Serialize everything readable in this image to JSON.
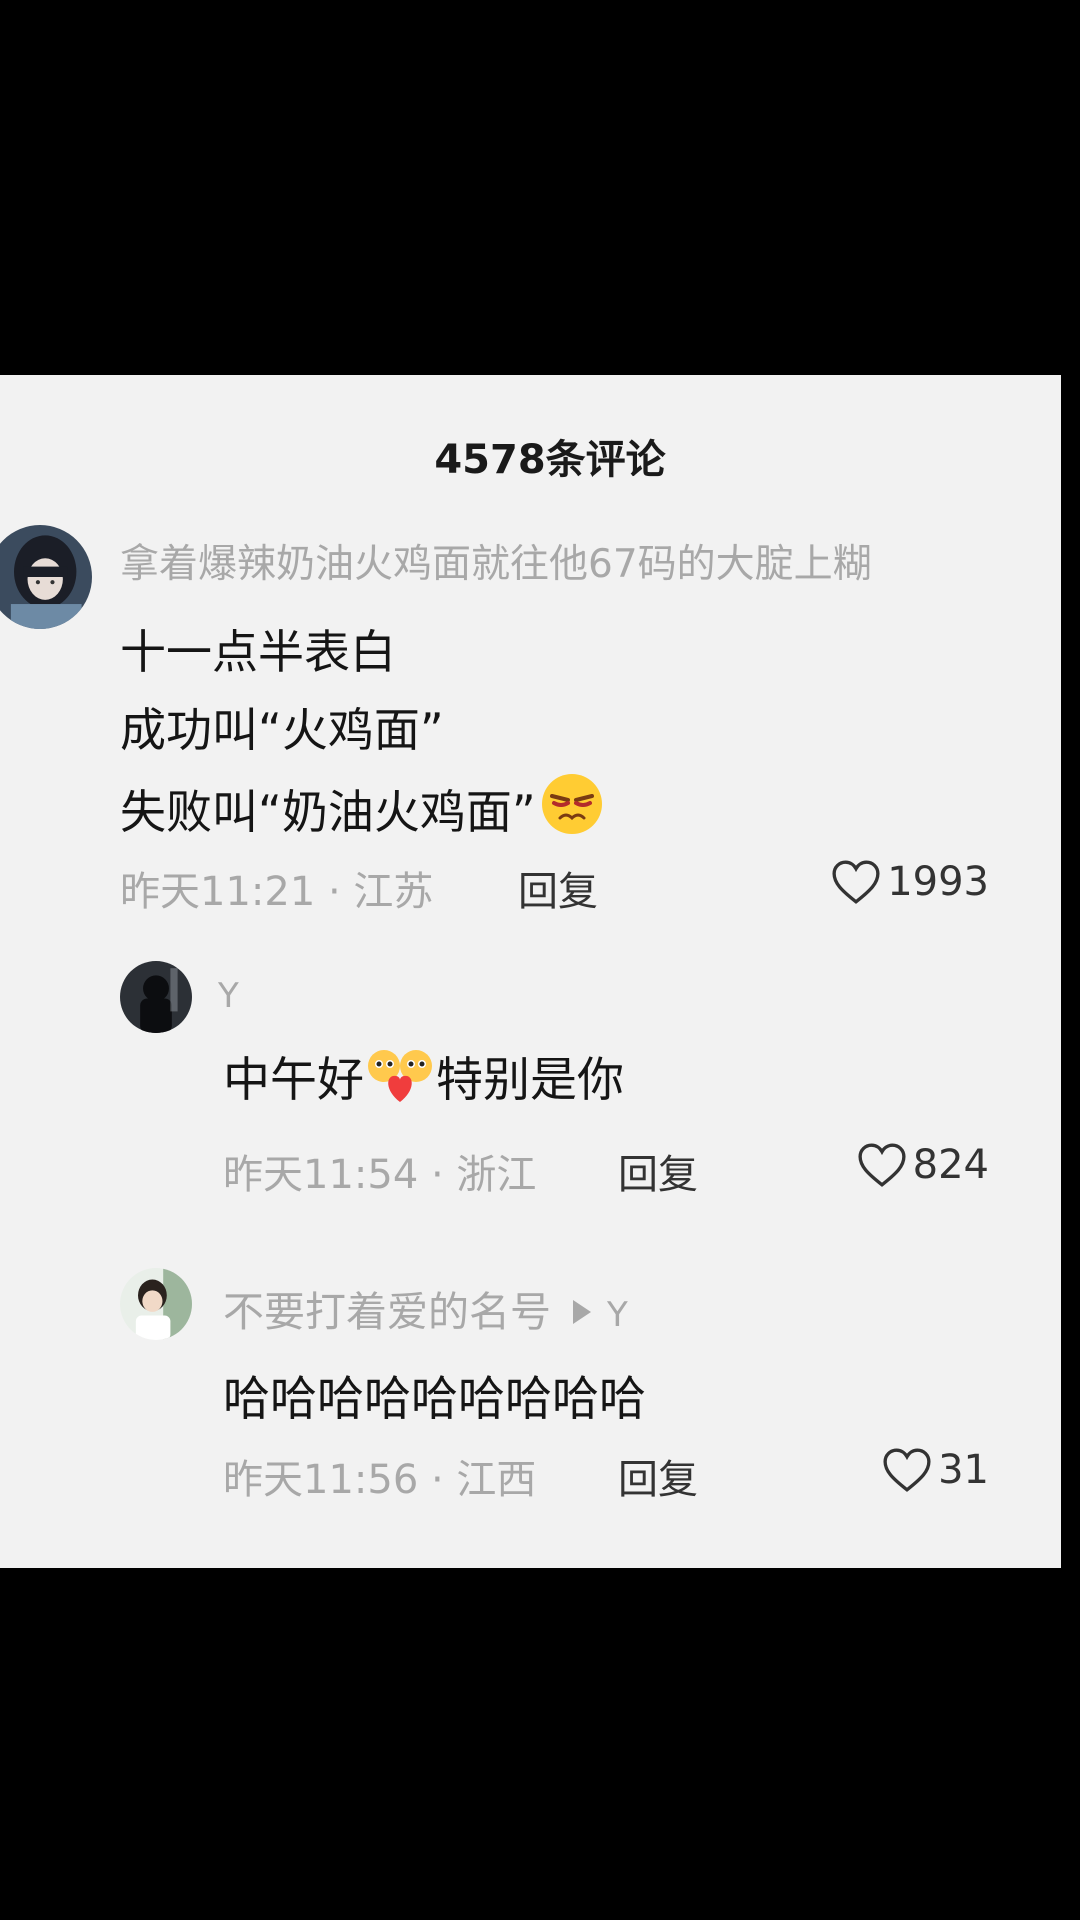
{
  "header": {
    "title": "4578条评论"
  },
  "comments": [
    {
      "username": "拿着爆辣奶油火鸡面就往他67码的大腚上糊",
      "lines": [
        "十一点半表白",
        "成功叫“火鸡面”",
        "失败叫“奶油火鸡面”"
      ],
      "emoji": "squinting-annoyed-emoji",
      "meta": "昨天11:21 · 江苏",
      "reply_label": "回复",
      "likes": "1993"
    },
    {
      "username": "Y",
      "text": "中午好",
      "text_after": "特别是你",
      "emoji": "heart-hug-emoji",
      "meta": "昨天11:54 · 浙江",
      "reply_label": "回复",
      "likes": "824"
    },
    {
      "username": "不要打着爱的名号",
      "reply_to": "Y",
      "text": "哈哈哈哈哈哈哈哈哈",
      "meta": "昨天11:56 · 江西",
      "reply_label": "回复",
      "likes": "31"
    }
  ],
  "colors": {
    "background": "#000000",
    "panel": "#f2f2f2",
    "muted_text": "#a8a8a8",
    "main_text": "#151515"
  }
}
